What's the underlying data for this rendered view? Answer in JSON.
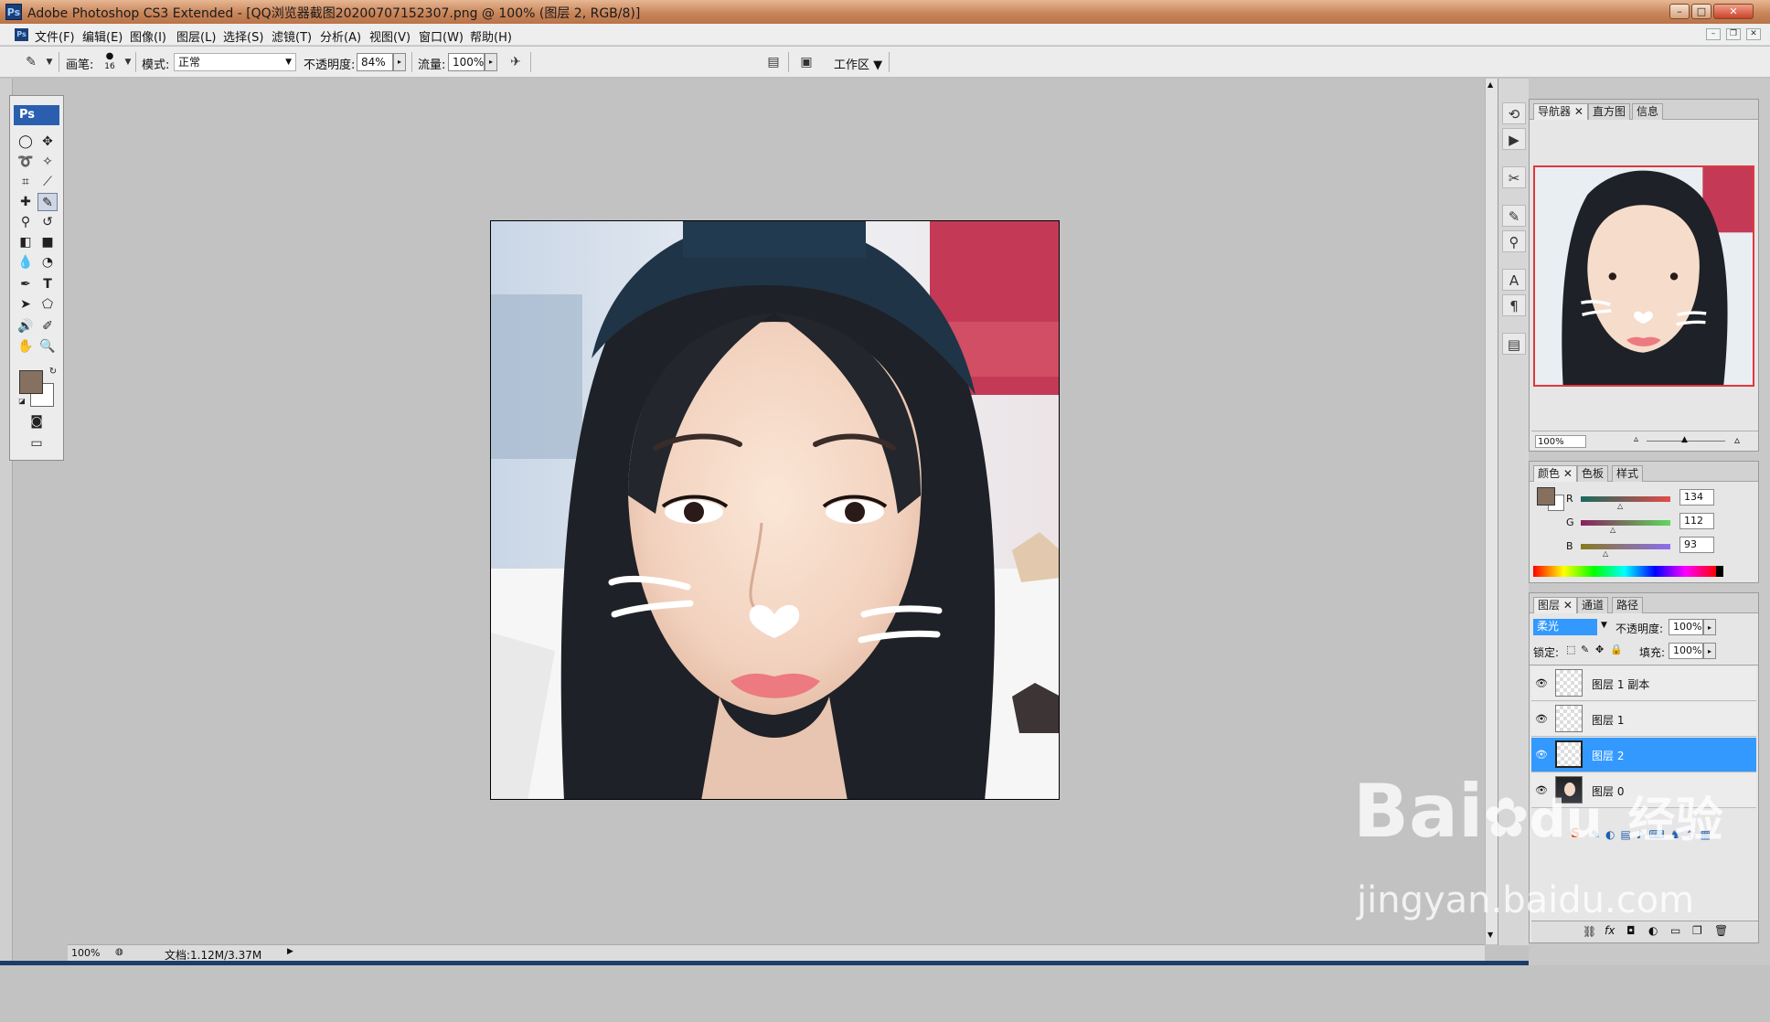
{
  "titlebar": {
    "title": "Adobe Photoshop CS3 Extended - [QQ浏览器截图20200707152307.png @ 100% (图层 2, RGB/8)]",
    "min": "–",
    "max": "□",
    "close": "✕"
  },
  "menu": [
    "文件(F)",
    "编辑(E)",
    "图像(I)",
    "图层(L)",
    "选择(S)",
    "滤镜(T)",
    "分析(A)",
    "视图(V)",
    "窗口(W)",
    "帮助(H)"
  ],
  "options": {
    "brush_label": "画笔:",
    "brush_size": "16",
    "mode_label": "模式:",
    "mode_value": "正常",
    "opacity_label": "不透明度:",
    "opacity_value": "84%",
    "flow_label": "流量:",
    "flow_value": "100%",
    "workspace_label": "工作区"
  },
  "toolbox": {
    "logo": "Ps",
    "foreground_color": "#867060",
    "background_color": "#ffffff"
  },
  "status": {
    "zoom": "100%",
    "doc": "文档:1.12M/3.37M"
  },
  "navigator": {
    "tabs": [
      "导航器",
      "直方图",
      "信息"
    ],
    "zoom": "100%"
  },
  "color_panel": {
    "tabs": [
      "颜色",
      "色板",
      "样式"
    ],
    "channels": [
      {
        "label": "R",
        "value": "134"
      },
      {
        "label": "G",
        "value": "112"
      },
      {
        "label": "B",
        "value": "93"
      }
    ],
    "current_color": "#86705d"
  },
  "layers_panel": {
    "tabs": [
      "图层",
      "通道",
      "路径"
    ],
    "blend_mode": "柔光",
    "opacity_label": "不透明度:",
    "opacity_value": "100%",
    "lock_label": "锁定:",
    "fill_label": "填充:",
    "fill_value": "100%",
    "layers": [
      {
        "name": "图层 1 副本",
        "selected": false
      },
      {
        "name": "图层 1",
        "selected": false
      },
      {
        "name": "图层 2",
        "selected": true
      },
      {
        "name": "图层 0",
        "selected": false
      }
    ]
  },
  "watermark": {
    "brand_latin": "Bai",
    "brand_cjk": "经验",
    "url": "jingyan.baidu.com"
  }
}
